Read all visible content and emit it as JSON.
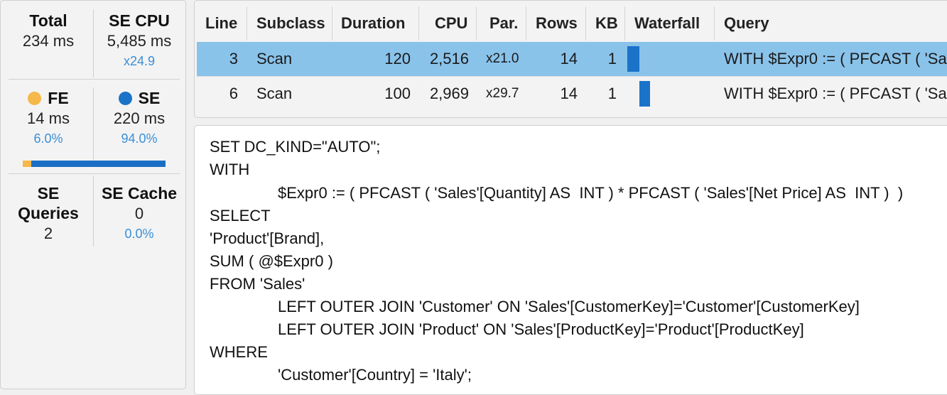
{
  "metrics": {
    "total": {
      "label": "Total",
      "value": "234 ms"
    },
    "se_cpu": {
      "label": "SE CPU",
      "value": "5,485 ms",
      "sub": "x24.9"
    },
    "fe": {
      "label": "FE",
      "value": "14 ms",
      "sub": "6.0%",
      "color": "#f5b84a"
    },
    "se": {
      "label": "SE",
      "value": "220 ms",
      "sub": "94.0%",
      "color": "#1a73c8"
    },
    "split_fraction": {
      "fe": 0.06,
      "se": 0.94
    },
    "se_queries": {
      "label": "SE Queries",
      "value": "2"
    },
    "se_cache": {
      "label": "SE Cache",
      "value": "0",
      "sub": "0.0%"
    }
  },
  "table": {
    "headers": [
      "Line",
      "Subclass",
      "Duration",
      "CPU",
      "Par.",
      "Rows",
      "KB",
      "Waterfall",
      "Query"
    ],
    "rows": [
      {
        "line": "3",
        "subclass": "Scan",
        "duration": "120",
        "cpu": "2,516",
        "par": "x21.0",
        "rows": "14",
        "kb": "1",
        "waterfall": {
          "start": 0.0,
          "length": 0.51
        },
        "query": "WITH $Expr0 := ( PFCAST ( 'Sa",
        "selected": true
      },
      {
        "line": "6",
        "subclass": "Scan",
        "duration": "100",
        "cpu": "2,969",
        "par": "x29.7",
        "rows": "14",
        "kb": "1",
        "waterfall": {
          "start": 0.51,
          "length": 0.43
        },
        "query": "WITH $Expr0 := ( PFCAST ( 'Sa",
        "selected": false
      }
    ]
  },
  "query_text": [
    {
      "indent": false,
      "text": "SET DC_KIND=\"AUTO\";"
    },
    {
      "indent": false,
      "text": "WITH"
    },
    {
      "indent": true,
      "text": "$Expr0 := ( PFCAST ( 'Sales'[Quantity] AS  INT ) * PFCAST ( 'Sales'[Net Price] AS  INT )  )"
    },
    {
      "indent": false,
      "text": "SELECT"
    },
    {
      "indent": false,
      "text": "'Product'[Brand],"
    },
    {
      "indent": false,
      "text": "SUM ( @$Expr0 )"
    },
    {
      "indent": false,
      "text": "FROM 'Sales'"
    },
    {
      "indent": true,
      "text": "LEFT OUTER JOIN 'Customer' ON 'Sales'[CustomerKey]='Customer'[CustomerKey]"
    },
    {
      "indent": true,
      "text": "LEFT OUTER JOIN 'Product' ON 'Sales'[ProductKey]='Product'[ProductKey]"
    },
    {
      "indent": false,
      "text": "WHERE"
    },
    {
      "indent": true,
      "text": "'Customer'[Country] = 'Italy';"
    }
  ]
}
